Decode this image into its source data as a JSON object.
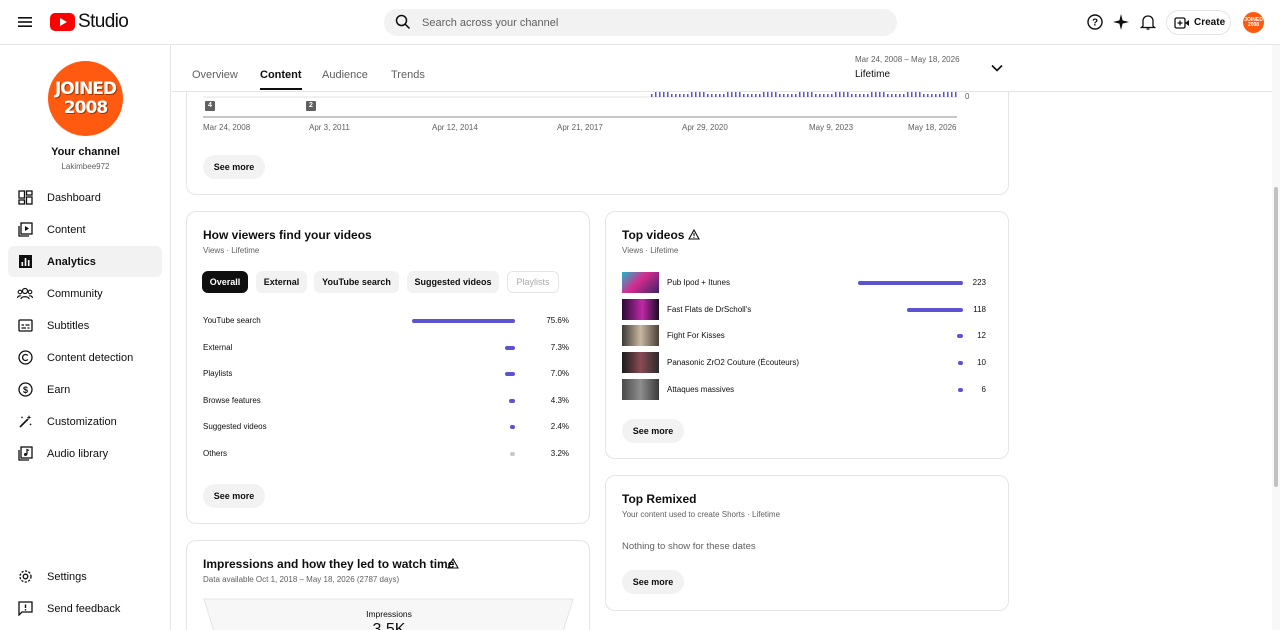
{
  "header": {
    "app_name": "Studio",
    "search_placeholder": "Search across your channel",
    "create_label": "Create",
    "avatar_text_line1": "JOINED",
    "avatar_text_line2": "2008"
  },
  "sidebar": {
    "avatar_line1": "JOINED",
    "avatar_line2": "2008",
    "channel_name": "Your channel",
    "channel_handle": "Lakimbee972",
    "items": [
      {
        "label": "Dashboard",
        "icon": "dashboard-icon"
      },
      {
        "label": "Content",
        "icon": "content-icon"
      },
      {
        "label": "Analytics",
        "icon": "analytics-icon",
        "active": true
      },
      {
        "label": "Community",
        "icon": "community-icon"
      },
      {
        "label": "Subtitles",
        "icon": "subtitles-icon"
      },
      {
        "label": "Content detection",
        "icon": "copyright-icon"
      },
      {
        "label": "Earn",
        "icon": "dollar-icon"
      },
      {
        "label": "Customization",
        "icon": "magic-wand-icon"
      },
      {
        "label": "Audio library",
        "icon": "audio-library-icon"
      }
    ],
    "footer": [
      {
        "label": "Settings",
        "icon": "gear-icon"
      },
      {
        "label": "Send feedback",
        "icon": "feedback-icon"
      }
    ]
  },
  "tabs": [
    "Overview",
    "Content",
    "Audience",
    "Trends"
  ],
  "active_tab": "Content",
  "date_range": {
    "range": "Mar 24, 2008 – May 18, 2026",
    "period": "Lifetime"
  },
  "timeline": {
    "x_labels": [
      "Mar 24, 2008",
      "Apr 3, 2011",
      "Apr 12, 2014",
      "Apr 21, 2017",
      "Apr 29, 2020",
      "May 9, 2023",
      "May 18, 2026"
    ],
    "y_zero": "0",
    "markers": [
      "4",
      "2"
    ],
    "see_more": "See more"
  },
  "traffic": {
    "title": "How viewers find your videos",
    "subtitle": "Views · Lifetime",
    "chips": [
      "Overall",
      "External",
      "YouTube search",
      "Suggested videos",
      "Playlists"
    ],
    "rows": [
      {
        "name": "YouTube search",
        "pct": "75.6%",
        "value": 75.6
      },
      {
        "name": "External",
        "pct": "7.3%",
        "value": 7.3
      },
      {
        "name": "Playlists",
        "pct": "7.0%",
        "value": 7.0
      },
      {
        "name": "Browse features",
        "pct": "4.3%",
        "value": 4.3
      },
      {
        "name": "Suggested videos",
        "pct": "2.4%",
        "value": 2.4
      },
      {
        "name": "Others",
        "pct": "3.2%",
        "value": 3.2
      }
    ],
    "see_more": "See more"
  },
  "top_videos": {
    "title": "Top videos",
    "subtitle": "Views · Lifetime",
    "rows": [
      {
        "name": "Pub Ipod + Itunes",
        "views": "223",
        "value": 223
      },
      {
        "name": "Fast Flats de DrScholl's",
        "views": "118",
        "value": 118
      },
      {
        "name": "Fight For Kisses",
        "views": "12",
        "value": 12
      },
      {
        "name": "Panasonic ZrO2 Couture (Écouteurs)",
        "views": "10",
        "value": 10
      },
      {
        "name": "Attaques massives",
        "views": "6",
        "value": 6
      }
    ],
    "see_more": "See more"
  },
  "top_remixed": {
    "title": "Top Remixed",
    "subtitle": "Your content used to create Shorts · Lifetime",
    "empty": "Nothing to show for these dates",
    "see_more": "See more"
  },
  "impressions": {
    "title": "Impressions and how they led to watch time",
    "subtitle": "Data available Oct 1, 2018 – May 18, 2026 (2787 days)",
    "funnel_label": "Impressions",
    "funnel_value": "3.5K"
  },
  "colors": {
    "accent": "#5b53d1",
    "brand_red": "#ff0000",
    "avatar": "#ff5a0f"
  }
}
